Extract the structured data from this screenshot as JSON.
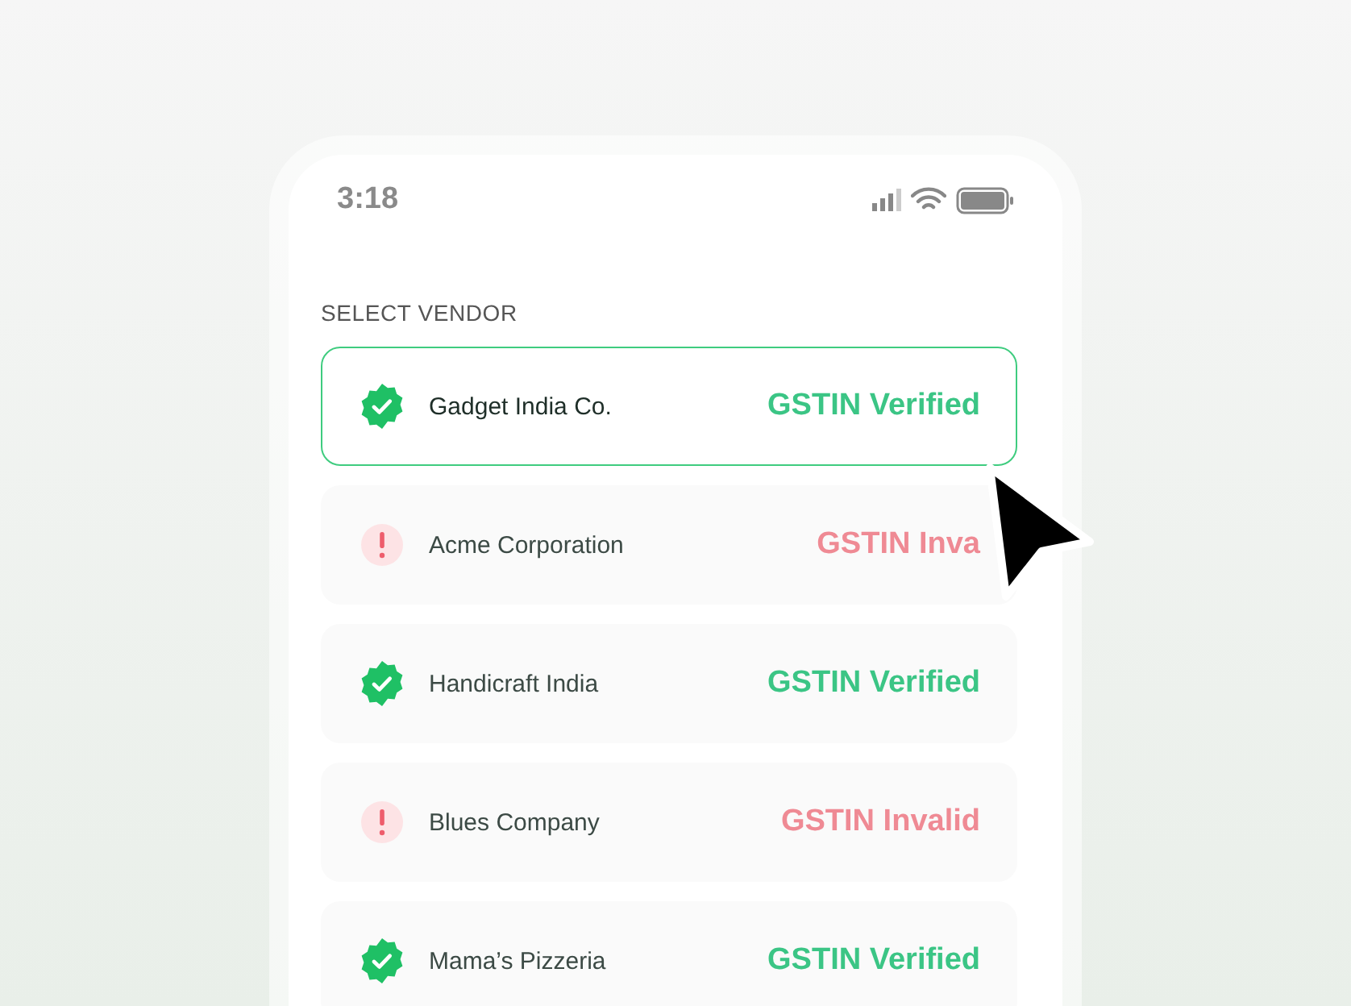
{
  "status_bar": {
    "time": "3:18"
  },
  "heading": "SELECT VENDOR",
  "vendors": [
    {
      "name": "Gadget India Co.",
      "status": "GSTIN Verified",
      "kind": "verified",
      "selected": true
    },
    {
      "name": "Acme Corporation",
      "status": "GSTIN Inva",
      "kind": "invalid",
      "selected": false
    },
    {
      "name": "Handicraft India",
      "status": "GSTIN Verified",
      "kind": "verified",
      "selected": false
    },
    {
      "name": "Blues Company",
      "status": "GSTIN Invalid",
      "kind": "invalid",
      "selected": false
    },
    {
      "name": "Mama’s Pizzeria",
      "status": "GSTIN Verified",
      "kind": "verified",
      "selected": false
    }
  ]
}
